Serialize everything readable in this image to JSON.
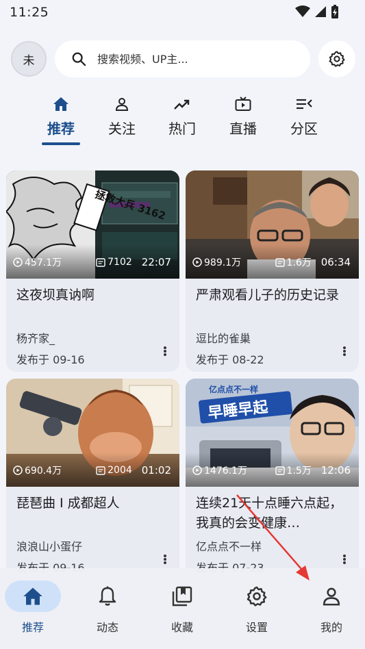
{
  "status": {
    "time": "11:25"
  },
  "header": {
    "avatar_text": "未",
    "search_placeholder": "搜索视频、UP主...",
    "icons": {
      "search": "search-icon",
      "settings": "gear-icon"
    }
  },
  "tabs": [
    {
      "label": "推荐",
      "icon": "home-icon",
      "active": true
    },
    {
      "label": "关注",
      "icon": "person-icon"
    },
    {
      "label": "热门",
      "icon": "trending-icon"
    },
    {
      "label": "直播",
      "icon": "tv-icon"
    },
    {
      "label": "分区",
      "icon": "list-icon"
    }
  ],
  "videos": [
    {
      "title": "这夜坝真讷啊",
      "author": "杨齐家_",
      "date": "发布于 09-16",
      "views": "457.1万",
      "danmaku": "7102",
      "duration": "22:07",
      "thumb_text": "拯救大兵 3162"
    },
    {
      "title": "严肃观看儿子的历史记录",
      "author": "逗比的雀巢",
      "date": "发布于 08-22",
      "views": "989.1万",
      "danmaku": "1.6万",
      "duration": "06:34"
    },
    {
      "title": "琵琶曲 I 成都超人",
      "author": "浪浪山小蛋仔",
      "date": "发布于 09-16",
      "views": "690.4万",
      "danmaku": "2004",
      "duration": "01:02"
    },
    {
      "title": "连续21天十点睡六点起，我真的会变健康…",
      "author": "亿点点不一样",
      "date": "发布于 07-23",
      "views": "1476.1万",
      "danmaku": "1.5万",
      "duration": "12:06",
      "thumb_text": "早睡早起",
      "thumb_sub": "亿点点不一样"
    }
  ],
  "bottom_nav": [
    {
      "label": "推荐",
      "icon": "home-icon",
      "active": true
    },
    {
      "label": "动态",
      "icon": "bell-icon"
    },
    {
      "label": "收藏",
      "icon": "bookmark-icon"
    },
    {
      "label": "设置",
      "icon": "gear-icon"
    },
    {
      "label": "我的",
      "icon": "person-icon"
    }
  ],
  "colors": {
    "accent": "#1d4f8c",
    "active_pill": "#cfe1f8",
    "background": "#f2f4fa",
    "card": "#e9ebf2",
    "annotation_arrow": "#e53935"
  }
}
